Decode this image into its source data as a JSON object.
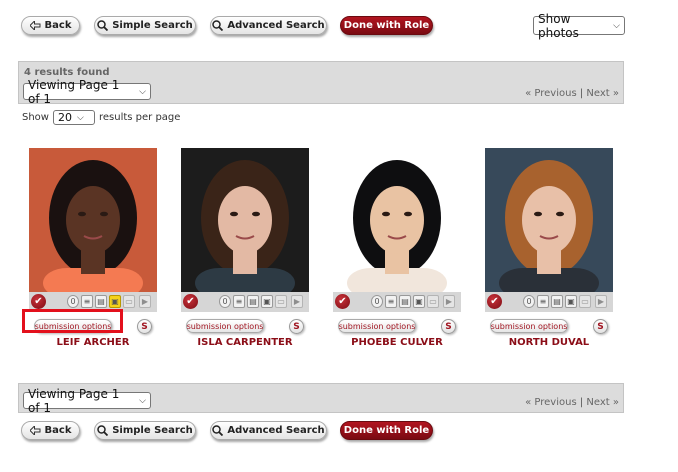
{
  "top_nav": {
    "back": "Back",
    "simple_search": "Simple Search",
    "advanced_search": "Advanced Search",
    "done": "Done with Role",
    "show_photos": "Show photos"
  },
  "results_bar": {
    "found": "4 results found",
    "viewing": "Viewing Page 1 of 1",
    "previous": "« Previous",
    "separator": "|",
    "next": "Next »"
  },
  "per_page": {
    "show": "Show",
    "value": "20",
    "suffix": "results per page"
  },
  "actors": [
    {
      "name": "LEIF ARCHER",
      "submission": "submission options",
      "s": "S",
      "bg": "#c85a3a",
      "skin": "#5a3424",
      "hair": "#1a1110",
      "shirt": "#f47a52"
    },
    {
      "name": "ISLA CARPENTER",
      "submission": "submission options",
      "s": "S",
      "bg": "#1c1c1c",
      "skin": "#e3b9a4",
      "hair": "#3a2418",
      "shirt": "#2d3a44"
    },
    {
      "name": "PHOEBE CULVER",
      "submission": "submission options",
      "s": "S",
      "bg": "#ffffff",
      "skin": "#e9c3a3",
      "hair": "#0e0e10",
      "shirt": "#f1e6dc"
    },
    {
      "name": "NORTH DUVAL",
      "submission": "submission options",
      "s": "S",
      "bg": "#37495a",
      "skin": "#e8c0a8",
      "hair": "#a8622e",
      "shirt": "#2a3038"
    }
  ],
  "bottom_bar": {
    "viewing": "Viewing Page 1 of 1",
    "previous": "« Previous",
    "separator": "|",
    "next": "Next »"
  },
  "bottom_nav": {
    "back": "Back",
    "simple_search": "Simple Search",
    "advanced_search": "Advanced Search",
    "done": "Done with Role"
  },
  "colors": {
    "accent": "#8b0d17",
    "highlight": "#e3101c"
  }
}
